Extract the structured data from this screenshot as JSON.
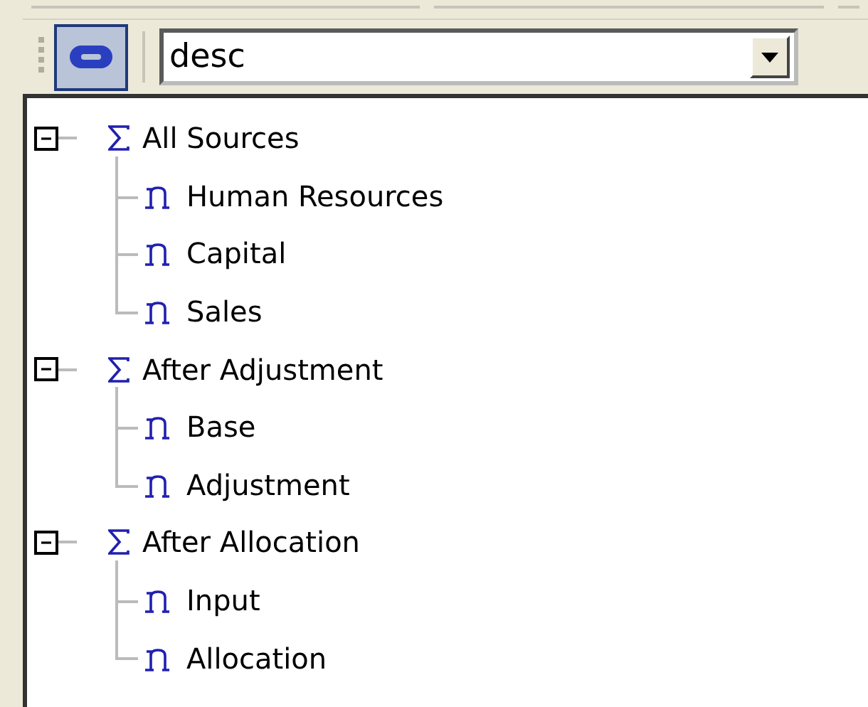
{
  "toolbar": {
    "link_button": {
      "pressed": true
    },
    "combo": {
      "value": "desc"
    }
  },
  "tree": [
    {
      "label": "All Sources",
      "kind": "sum",
      "expanded": true,
      "children": [
        {
          "label": "Human Resources",
          "kind": "member"
        },
        {
          "label": "Capital",
          "kind": "member"
        },
        {
          "label": "Sales",
          "kind": "member"
        }
      ]
    },
    {
      "label": "After Adjustment",
      "kind": "sum",
      "expanded": true,
      "children": [
        {
          "label": "Base",
          "kind": "member"
        },
        {
          "label": "Adjustment",
          "kind": "member"
        }
      ]
    },
    {
      "label": "After Allocation",
      "kind": "sum",
      "expanded": true,
      "children": [
        {
          "label": "Input",
          "kind": "member"
        },
        {
          "label": "Allocation",
          "kind": "member"
        }
      ]
    }
  ]
}
